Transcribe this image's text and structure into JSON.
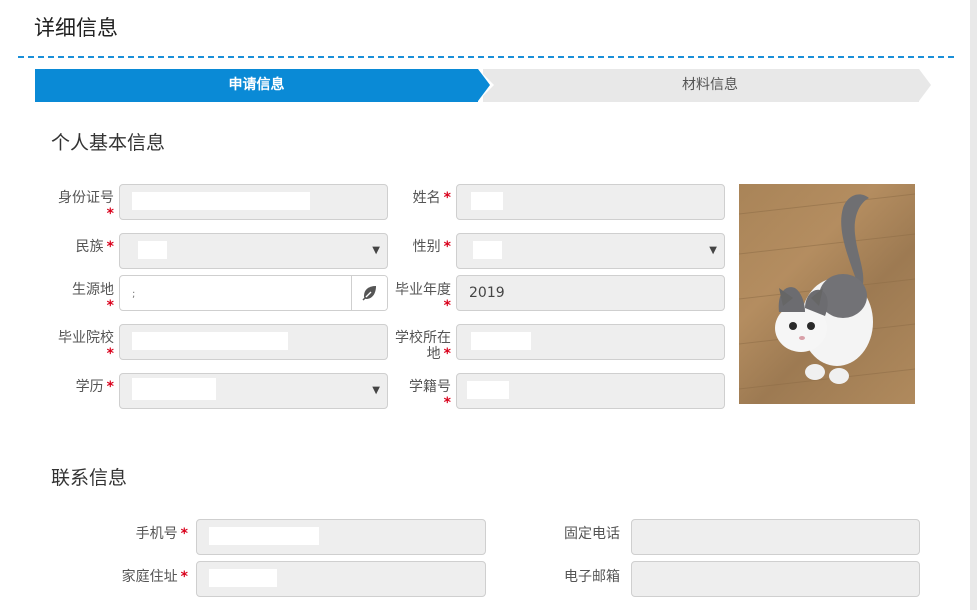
{
  "page": {
    "title": "详细信息"
  },
  "steps": [
    {
      "label": "申请信息",
      "active": true
    },
    {
      "label": "材料信息",
      "active": false
    }
  ],
  "colors": {
    "accent": "#0a8ad6",
    "required": "#d9001b",
    "field_bg": "#eeeeee"
  },
  "basic": {
    "title": "个人基本信息",
    "id_card": {
      "label": "身份证号",
      "value": ""
    },
    "name": {
      "label": "姓名",
      "value": ""
    },
    "ethnicity": {
      "label": "民族",
      "value": ""
    },
    "gender": {
      "label": "性别",
      "value": ""
    },
    "origin": {
      "label": "生源地",
      "value": ";"
    },
    "grad_year": {
      "label": "毕业年度",
      "value": "2019"
    },
    "school": {
      "label": "毕业院校",
      "value": ""
    },
    "school_location": {
      "label": "学校所在地",
      "value": ""
    },
    "education": {
      "label": "学历",
      "value": ""
    },
    "student_no": {
      "label": "学籍号",
      "value": ""
    },
    "photo": {
      "icon": "cat-photo"
    }
  },
  "contact": {
    "title": "联系信息",
    "mobile": {
      "label": "手机号",
      "value": ""
    },
    "landline": {
      "label": "固定电话",
      "value": ""
    },
    "address": {
      "label": "家庭住址",
      "value": ""
    },
    "email": {
      "label": "电子邮箱",
      "value": ""
    }
  },
  "req_mark": "*"
}
